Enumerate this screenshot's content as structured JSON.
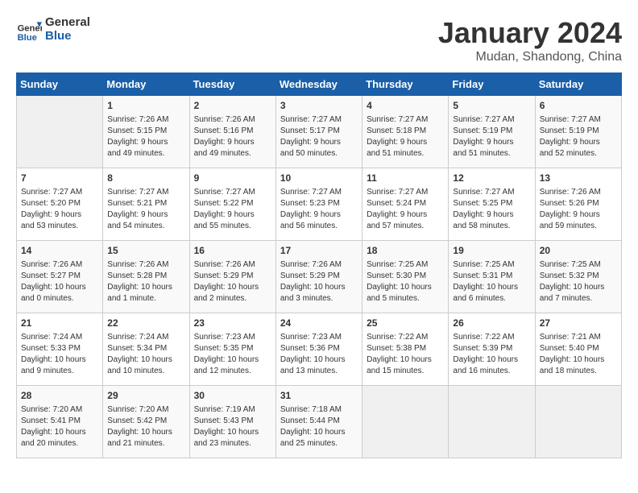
{
  "logo": {
    "line1": "General",
    "line2": "Blue"
  },
  "calendar": {
    "title": "January 2024",
    "subtitle": "Mudan, Shandong, China"
  },
  "weekdays": [
    "Sunday",
    "Monday",
    "Tuesday",
    "Wednesday",
    "Thursday",
    "Friday",
    "Saturday"
  ],
  "weeks": [
    [
      {
        "day": "",
        "info": ""
      },
      {
        "day": "1",
        "info": "Sunrise: 7:26 AM\nSunset: 5:15 PM\nDaylight: 9 hours\nand 49 minutes."
      },
      {
        "day": "2",
        "info": "Sunrise: 7:26 AM\nSunset: 5:16 PM\nDaylight: 9 hours\nand 49 minutes."
      },
      {
        "day": "3",
        "info": "Sunrise: 7:27 AM\nSunset: 5:17 PM\nDaylight: 9 hours\nand 50 minutes."
      },
      {
        "day": "4",
        "info": "Sunrise: 7:27 AM\nSunset: 5:18 PM\nDaylight: 9 hours\nand 51 minutes."
      },
      {
        "day": "5",
        "info": "Sunrise: 7:27 AM\nSunset: 5:19 PM\nDaylight: 9 hours\nand 51 minutes."
      },
      {
        "day": "6",
        "info": "Sunrise: 7:27 AM\nSunset: 5:19 PM\nDaylight: 9 hours\nand 52 minutes."
      }
    ],
    [
      {
        "day": "7",
        "info": "Sunrise: 7:27 AM\nSunset: 5:20 PM\nDaylight: 9 hours\nand 53 minutes."
      },
      {
        "day": "8",
        "info": "Sunrise: 7:27 AM\nSunset: 5:21 PM\nDaylight: 9 hours\nand 54 minutes."
      },
      {
        "day": "9",
        "info": "Sunrise: 7:27 AM\nSunset: 5:22 PM\nDaylight: 9 hours\nand 55 minutes."
      },
      {
        "day": "10",
        "info": "Sunrise: 7:27 AM\nSunset: 5:23 PM\nDaylight: 9 hours\nand 56 minutes."
      },
      {
        "day": "11",
        "info": "Sunrise: 7:27 AM\nSunset: 5:24 PM\nDaylight: 9 hours\nand 57 minutes."
      },
      {
        "day": "12",
        "info": "Sunrise: 7:27 AM\nSunset: 5:25 PM\nDaylight: 9 hours\nand 58 minutes."
      },
      {
        "day": "13",
        "info": "Sunrise: 7:26 AM\nSunset: 5:26 PM\nDaylight: 9 hours\nand 59 minutes."
      }
    ],
    [
      {
        "day": "14",
        "info": "Sunrise: 7:26 AM\nSunset: 5:27 PM\nDaylight: 10 hours\nand 0 minutes."
      },
      {
        "day": "15",
        "info": "Sunrise: 7:26 AM\nSunset: 5:28 PM\nDaylight: 10 hours\nand 1 minute."
      },
      {
        "day": "16",
        "info": "Sunrise: 7:26 AM\nSunset: 5:29 PM\nDaylight: 10 hours\nand 2 minutes."
      },
      {
        "day": "17",
        "info": "Sunrise: 7:26 AM\nSunset: 5:29 PM\nDaylight: 10 hours\nand 3 minutes."
      },
      {
        "day": "18",
        "info": "Sunrise: 7:25 AM\nSunset: 5:30 PM\nDaylight: 10 hours\nand 5 minutes."
      },
      {
        "day": "19",
        "info": "Sunrise: 7:25 AM\nSunset: 5:31 PM\nDaylight: 10 hours\nand 6 minutes."
      },
      {
        "day": "20",
        "info": "Sunrise: 7:25 AM\nSunset: 5:32 PM\nDaylight: 10 hours\nand 7 minutes."
      }
    ],
    [
      {
        "day": "21",
        "info": "Sunrise: 7:24 AM\nSunset: 5:33 PM\nDaylight: 10 hours\nand 9 minutes."
      },
      {
        "day": "22",
        "info": "Sunrise: 7:24 AM\nSunset: 5:34 PM\nDaylight: 10 hours\nand 10 minutes."
      },
      {
        "day": "23",
        "info": "Sunrise: 7:23 AM\nSunset: 5:35 PM\nDaylight: 10 hours\nand 12 minutes."
      },
      {
        "day": "24",
        "info": "Sunrise: 7:23 AM\nSunset: 5:36 PM\nDaylight: 10 hours\nand 13 minutes."
      },
      {
        "day": "25",
        "info": "Sunrise: 7:22 AM\nSunset: 5:38 PM\nDaylight: 10 hours\nand 15 minutes."
      },
      {
        "day": "26",
        "info": "Sunrise: 7:22 AM\nSunset: 5:39 PM\nDaylight: 10 hours\nand 16 minutes."
      },
      {
        "day": "27",
        "info": "Sunrise: 7:21 AM\nSunset: 5:40 PM\nDaylight: 10 hours\nand 18 minutes."
      }
    ],
    [
      {
        "day": "28",
        "info": "Sunrise: 7:20 AM\nSunset: 5:41 PM\nDaylight: 10 hours\nand 20 minutes."
      },
      {
        "day": "29",
        "info": "Sunrise: 7:20 AM\nSunset: 5:42 PM\nDaylight: 10 hours\nand 21 minutes."
      },
      {
        "day": "30",
        "info": "Sunrise: 7:19 AM\nSunset: 5:43 PM\nDaylight: 10 hours\nand 23 minutes."
      },
      {
        "day": "31",
        "info": "Sunrise: 7:18 AM\nSunset: 5:44 PM\nDaylight: 10 hours\nand 25 minutes."
      },
      {
        "day": "",
        "info": ""
      },
      {
        "day": "",
        "info": ""
      },
      {
        "day": "",
        "info": ""
      }
    ]
  ]
}
